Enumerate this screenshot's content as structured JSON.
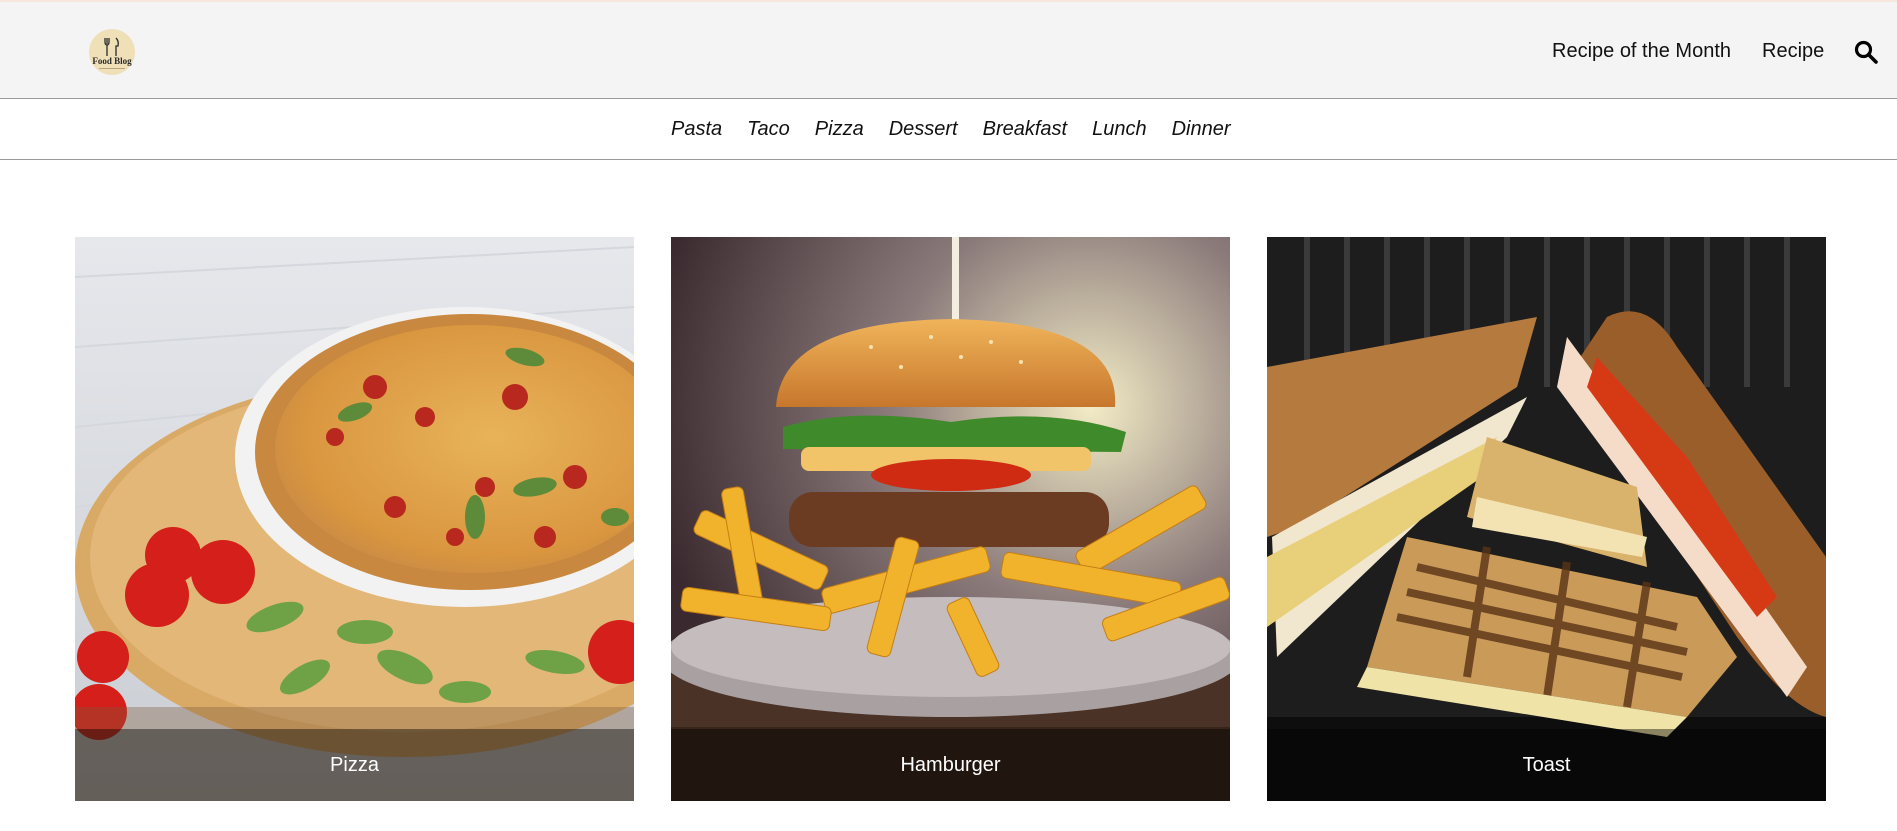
{
  "header": {
    "logo_text": "Food Blog",
    "nav": [
      {
        "label": "Recipe of the Month"
      },
      {
        "label": "Recipe"
      }
    ],
    "search_icon": "search-icon"
  },
  "categories": [
    "Pasta",
    "Taco",
    "Pizza",
    "Dessert",
    "Breakfast",
    "Lunch",
    "Dinner"
  ],
  "cards": [
    {
      "title": "Pizza"
    },
    {
      "title": "Hamburger"
    },
    {
      "title": "Toast"
    }
  ],
  "colors": {
    "header_bg": "#f4f4f4",
    "caption_overlay": "rgba(0,0,0,0.42)"
  }
}
